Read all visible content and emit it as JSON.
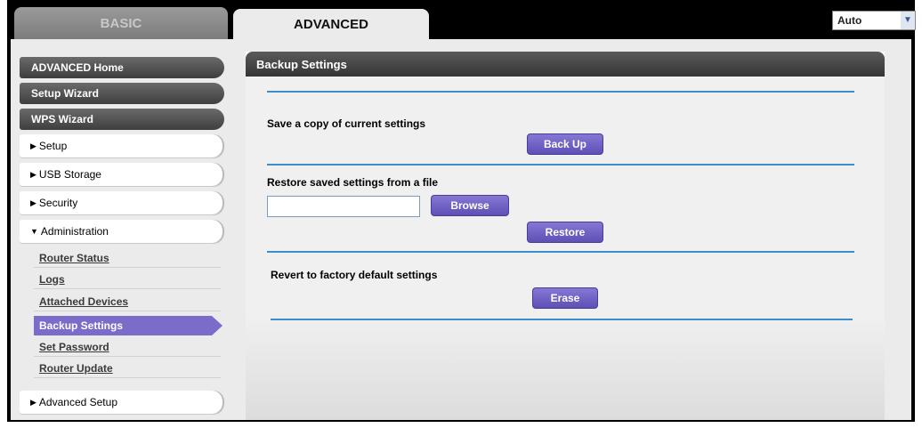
{
  "tabs": {
    "basic": "BASIC",
    "advanced": "ADVANCED"
  },
  "language": {
    "selected": "Auto"
  },
  "sidebar": {
    "advanced_home": "ADVANCED Home",
    "setup_wizard": "Setup Wizard",
    "wps_wizard": "WPS Wizard",
    "setup": "Setup",
    "usb_storage": "USB Storage",
    "security": "Security",
    "administration": "Administration",
    "admin_items": [
      "Router Status",
      "Logs",
      "Attached Devices",
      "Backup Settings",
      "Set Password",
      "Router Update"
    ],
    "advanced_setup": "Advanced Setup"
  },
  "panel": {
    "title": "Backup Settings",
    "save_label": "Save a copy of current settings",
    "backup_button": "Back Up",
    "restore_label": "Restore saved settings from a file",
    "browse_button": "Browse",
    "file_value": "",
    "restore_button": "Restore",
    "revert_label": "Revert to factory default settings",
    "erase_button": "Erase"
  },
  "colors": {
    "accent": "#7a6cc8",
    "rule": "#3b8fd0"
  }
}
